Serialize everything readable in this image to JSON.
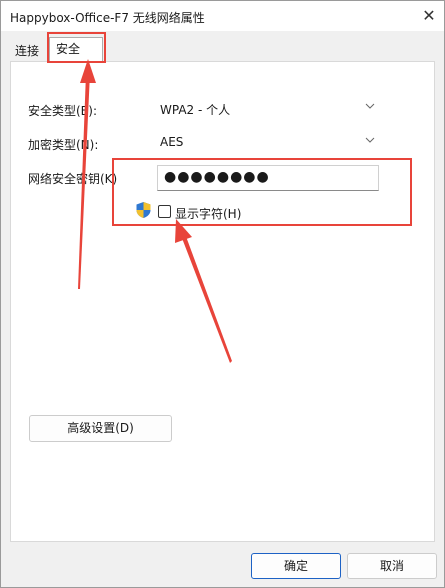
{
  "window": {
    "title": "Happybox-Office-F7 无线网络属性",
    "close_glyph": "✕"
  },
  "tabs": [
    {
      "label": "连接",
      "active": false
    },
    {
      "label": "安全",
      "active": true
    }
  ],
  "security": {
    "security_type_label": "安全类型(E):",
    "security_type_value": "WPA2 - 个人",
    "encryption_type_label": "加密类型(N):",
    "encryption_type_value": "AES",
    "key_label": "网络安全密钥(K)",
    "key_value": "●●●●●●●●",
    "show_chars_label": "显示字符(H)",
    "show_chars_checked": false
  },
  "buttons": {
    "advanced": "高级设置(D)",
    "ok": "确定",
    "cancel": "取消"
  },
  "colors": {
    "annotation": "#e8443a",
    "accent": "#1d62c5"
  },
  "icons": {
    "shield": "uac-shield-icon",
    "chevron": "chevron-down-icon",
    "close": "close-icon"
  }
}
